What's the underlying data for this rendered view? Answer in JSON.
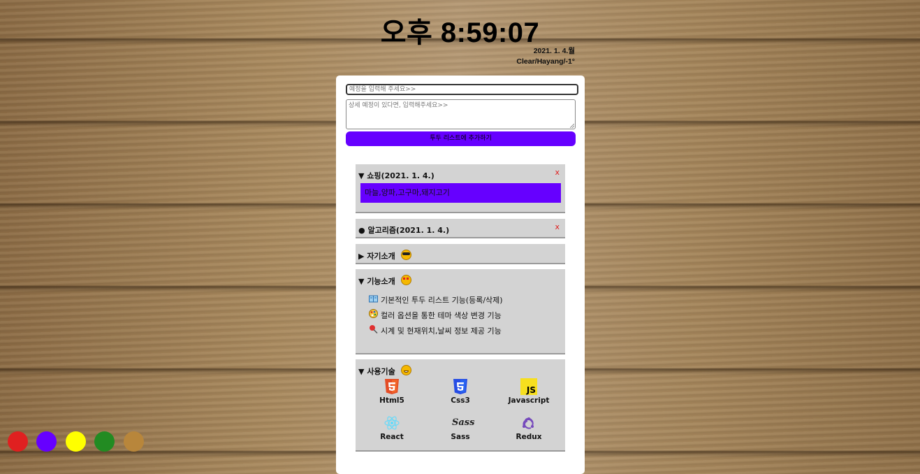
{
  "clock": {
    "time": "오후 8:59:07",
    "date": "2021. 1. 4.월",
    "weather": "Clear/Hayang/-1°"
  },
  "form": {
    "title_placeholder": "예정을 입력해 주세요>>",
    "detail_placeholder": "상세 예정이 있다면, 입력해주세요>>",
    "add_label": "투두 리스트에 추가하기"
  },
  "todos": [
    {
      "marker": "▼",
      "title": "쇼핑(2021. 1. 4.)",
      "close": "x",
      "content": "마늘,양파,고구마,돼지고기"
    },
    {
      "marker": "●",
      "title": "알고리즘(2021. 1. 4.)",
      "close": "x"
    }
  ],
  "sections": {
    "intro": {
      "marker": "▶",
      "title": "자기소개"
    },
    "features": {
      "marker": "▼",
      "title": "기능소개",
      "items": [
        {
          "icon": "book-icon",
          "text": "기본적인 투두 리스트 기능(등록/삭제)"
        },
        {
          "icon": "palette-icon",
          "text": "컬러 옵션을 통한 테마 색상 변경 기능"
        },
        {
          "icon": "pin-icon",
          "text": "시계 및 현재위치,날씨 정보 제공 기능"
        }
      ]
    },
    "tech": {
      "marker": "▼",
      "title": "사용기술",
      "items": [
        {
          "icon": "html5-icon",
          "label": "Html5"
        },
        {
          "icon": "css3-icon",
          "label": "Css3"
        },
        {
          "icon": "javascript-icon",
          "label": "Javascript",
          "logo_text": "JS"
        },
        {
          "icon": "react-icon",
          "label": "React"
        },
        {
          "icon": "sass-icon",
          "label": "Sass",
          "logo_text": "Sass"
        },
        {
          "icon": "redux-icon",
          "label": "Redux"
        }
      ]
    }
  },
  "theme_colors": [
    {
      "name": "red",
      "hex": "#e02020"
    },
    {
      "name": "purple",
      "hex": "#6600ff"
    },
    {
      "name": "yellow",
      "hex": "#ffff00"
    },
    {
      "name": "green",
      "hex": "#228b22"
    },
    {
      "name": "brown",
      "hex": "#b8863b"
    }
  ],
  "accent": "#6600ff"
}
